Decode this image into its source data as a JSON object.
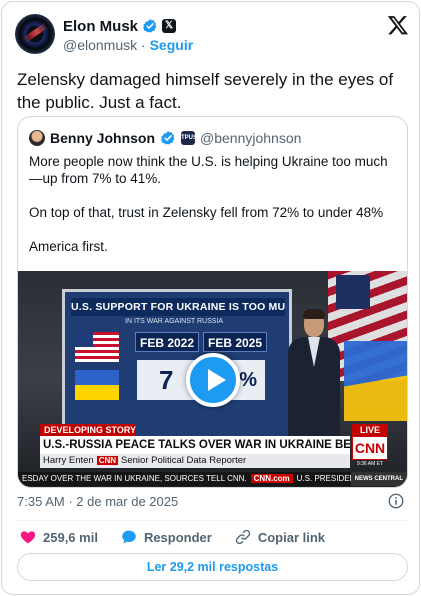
{
  "author": {
    "display_name": "Elon Musk",
    "handle": "@elonmusk",
    "separator": "·",
    "follow_label": "Seguir"
  },
  "tweet": {
    "text": "Zelensky damaged himself severely in the eyes of the public. Just a fact."
  },
  "quoted": {
    "display_name": "Benny Johnson",
    "handle": "@bennyjohnson",
    "badge_text": "TPUSA",
    "paragraphs": [
      "More people now think the U.S. is helping Ukraine too much—up from 7% to 41%.",
      "On top of that, trust in Zelensky fell from 72% to under 48%",
      "America first."
    ],
    "video": {
      "screen_title": "U.S. SUPPORT FOR UKRAINE IS TOO MUCH",
      "screen_subtitle": "IN ITS WAR AGAINST RUSSIA",
      "year_1": "FEB 2022",
      "year_2": "FEB 2025",
      "value_1": "7",
      "value_2": "%",
      "developing_label": "DEVELOPING STORY",
      "live_label": "LIVE",
      "headline": "U.S.-RUSSIA PEACE TALKS OVER WAR IN UKRAINE BEGIN TOMORROW",
      "byline_name": "Harry Enten",
      "byline_brand": "CNN",
      "byline_role": "Senior Political Data Reporter",
      "cnn_logo": "CNN",
      "cnn_time": "9:36 AM ET",
      "ticker_left": "ESDAY OVER THE WAR IN UKRAINE, SOURCES TELL CNN.",
      "ticker_brand": "CNN.com",
      "ticker_right": "U.S. PRESIDEN",
      "ticker_central": "NEWS CENTRAL"
    }
  },
  "meta": {
    "time": "7:35 AM",
    "separator": "·",
    "date": "2 de mar de 2025"
  },
  "actions": {
    "likes": "259,6 mil",
    "reply_label": "Responder",
    "copy_link_label": "Copiar link"
  },
  "replies_button": "Ler 29,2 mil respostas",
  "colors": {
    "accent": "#1d9bf0",
    "like": "#f91880",
    "text": "#0f1419",
    "muted": "#536471"
  },
  "icons": [
    "verified-badge-icon",
    "x-badge-icon",
    "x-logo-icon",
    "play-icon",
    "info-icon",
    "heart-icon",
    "reply-bubble-icon",
    "link-icon"
  ]
}
